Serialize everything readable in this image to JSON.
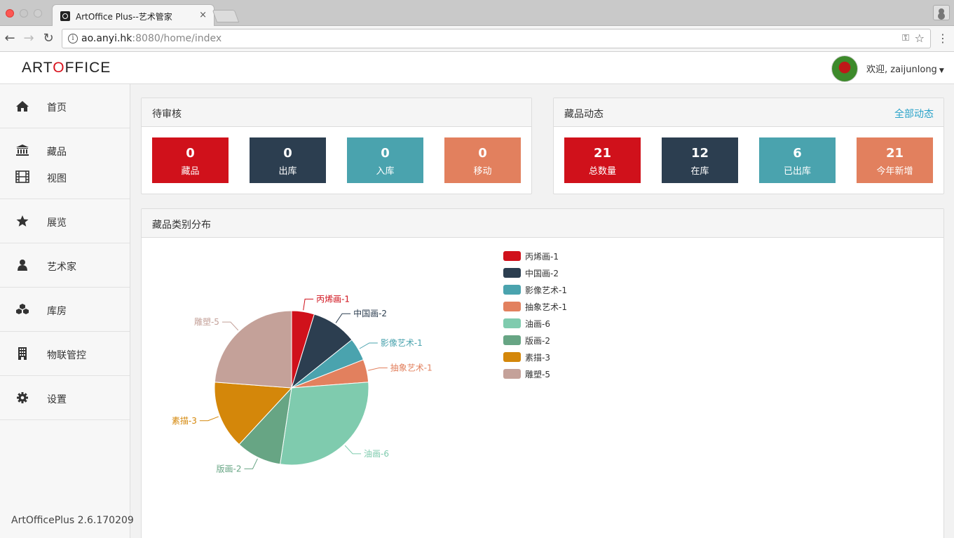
{
  "browser": {
    "tab_title": "ArtOffice Plus--艺术管家",
    "tab_close": "×",
    "url_host": "ao.anyi.hk",
    "url_path": ":8080/home/index"
  },
  "header": {
    "logo_a": "ART",
    "logo_b": "O",
    "logo_c": "FFICE",
    "welcome": "欢迎, zaijunlong"
  },
  "sidebar": {
    "items": [
      {
        "label": "首页",
        "icon": "home-icon"
      },
      {
        "label": "藏品",
        "icon": "bank-icon"
      },
      {
        "label": "视图",
        "icon": "film-icon"
      },
      {
        "label": "展览",
        "icon": "star-icon"
      },
      {
        "label": "艺术家",
        "icon": "user-icon"
      },
      {
        "label": "库房",
        "icon": "cubes-icon"
      },
      {
        "label": "物联管控",
        "icon": "building-icon"
      },
      {
        "label": "设置",
        "icon": "gear-icon"
      }
    ],
    "version": "ArtOfficePlus 2.6.170209"
  },
  "pending": {
    "title": "待审核",
    "stats": [
      {
        "value": "0",
        "label": "藏品",
        "color": "#d0111b"
      },
      {
        "value": "0",
        "label": "出库",
        "color": "#2c3e50"
      },
      {
        "value": "0",
        "label": "入库",
        "color": "#4aa3ae"
      },
      {
        "value": "0",
        "label": "移动",
        "color": "#e2805e"
      }
    ]
  },
  "activity": {
    "title": "藏品动态",
    "link": "全部动态",
    "stats": [
      {
        "value": "21",
        "label": "总数量",
        "color": "#d0111b"
      },
      {
        "value": "12",
        "label": "在库",
        "color": "#2c3e50"
      },
      {
        "value": "6",
        "label": "已出库",
        "color": "#4aa3ae"
      },
      {
        "value": "21",
        "label": "今年新增",
        "color": "#e2805e"
      }
    ]
  },
  "distribution": {
    "title": "藏品类别分布"
  },
  "chart_data": {
    "type": "pie",
    "title": "",
    "slices": [
      {
        "name": "丙烯画",
        "value": 1,
        "label": "丙烯画-1",
        "color": "#d0111b"
      },
      {
        "name": "中国画",
        "value": 2,
        "label": "中国画-2",
        "color": "#2c3e50"
      },
      {
        "name": "影像艺术",
        "value": 1,
        "label": "影像艺术-1",
        "color": "#4aa3ae"
      },
      {
        "name": "抽象艺术",
        "value": 1,
        "label": "抽象艺术-1",
        "color": "#e2805e"
      },
      {
        "name": "油画",
        "value": 6,
        "label": "油画-6",
        "color": "#7fcbae"
      },
      {
        "name": "版画",
        "value": 2,
        "label": "版画-2",
        "color": "#67a584"
      },
      {
        "name": "素描",
        "value": 3,
        "label": "素描-3",
        "color": "#d4870a"
      },
      {
        "name": "雕塑",
        "value": 5,
        "label": "雕塑-5",
        "color": "#c4a199"
      }
    ],
    "legend_position": "right"
  }
}
